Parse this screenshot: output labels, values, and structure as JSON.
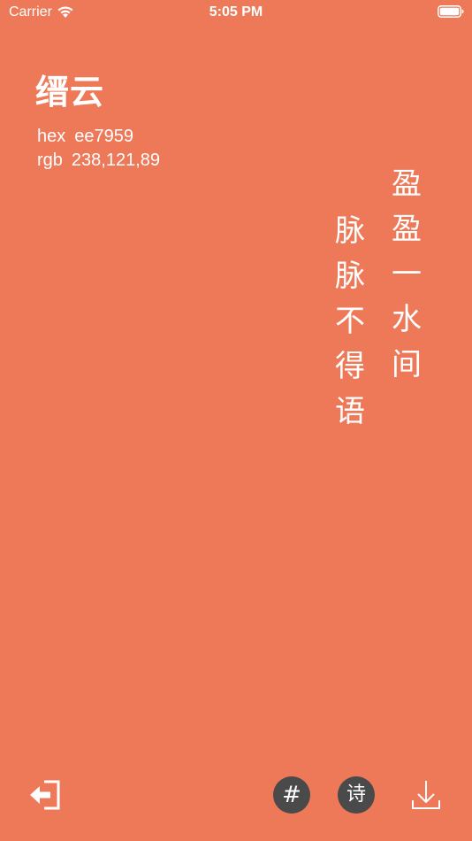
{
  "status_bar": {
    "carrier": "Carrier",
    "time": "5:05 PM",
    "wifi_icon": "wifi-icon",
    "battery_icon": "battery-icon"
  },
  "color": {
    "name": "缙云",
    "hex_label": "hex",
    "hex_value": "ee7959",
    "rgb_label": "rgb",
    "rgb_value": "238,121,89",
    "background": "#ee7959"
  },
  "poem": {
    "line1": [
      "盈",
      "盈",
      "一",
      "水",
      "间"
    ],
    "line2": [
      "脉",
      "脉",
      "不",
      "得",
      "语"
    ]
  },
  "toolbar": {
    "exit_icon": "exit-icon",
    "hash_label": "#",
    "poem_label": "诗",
    "download_icon": "download-icon",
    "button_color": "#4a4a4a"
  }
}
